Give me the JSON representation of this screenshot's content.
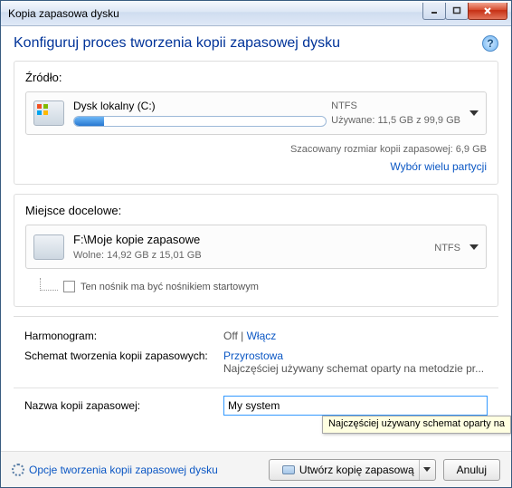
{
  "titlebar": {
    "title": "Kopia zapasowa dysku"
  },
  "heading": "Konfiguruj proces tworzenia kopii zapasowej dysku",
  "source": {
    "title": "Źródło:",
    "disk_name": "Dysk lokalny (C:)",
    "fs": "NTFS",
    "usage": "Używane: 11,5 GB z 99,9 GB",
    "estimate": "Szacowany rozmiar kopii zapasowej: 6,9 GB",
    "multi_link": "Wybór wielu partycji"
  },
  "destination": {
    "title": "Miejsce docelowe:",
    "path": "F:\\Moje kopie zapasowe",
    "free": "Wolne: 14,92 GB z 15,01 GB",
    "fs": "NTFS",
    "bootable_label": "Ten nośnik ma być nośnikiem startowym"
  },
  "settings": {
    "schedule_label": "Harmonogram:",
    "schedule_off": "Off",
    "schedule_sep": " | ",
    "schedule_link": "Włącz",
    "scheme_label": "Schemat tworzenia kopii zapasowych:",
    "scheme_link": "Przyrostowa",
    "scheme_desc": "Najczęściej używany schemat oparty na metodzie pr...",
    "name_label": "Nazwa kopii zapasowej:",
    "name_value": "My system"
  },
  "tooltip": "Najczęściej używany schemat oparty na",
  "footer": {
    "options": "Opcje tworzenia kopii zapasowej dysku",
    "create": "Utwórz kopię zapasową",
    "cancel": "Anuluj"
  }
}
